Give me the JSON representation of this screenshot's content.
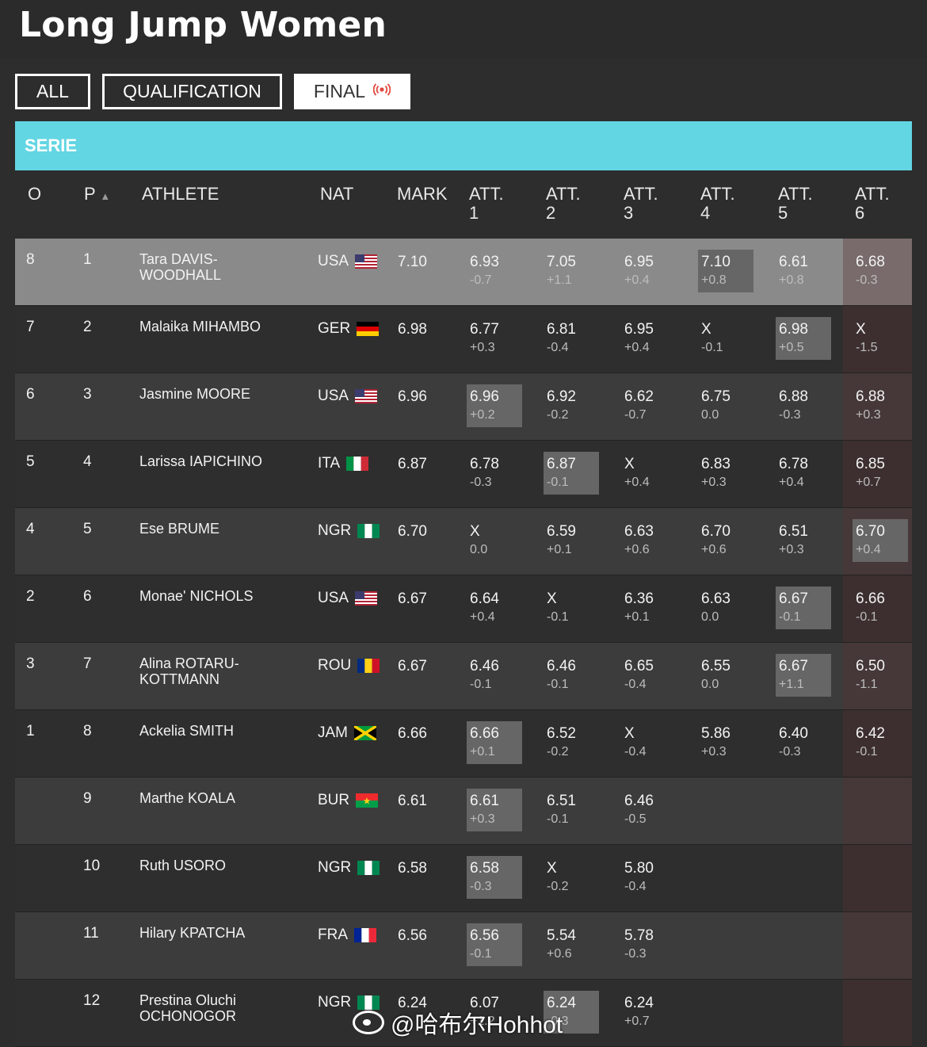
{
  "title": "Long Jump Women",
  "tabs": [
    {
      "label": "ALL",
      "active": false
    },
    {
      "label": "QUALIFICATION",
      "active": false
    },
    {
      "label": "FINAL",
      "active": true,
      "icon": "live-broadcast-icon"
    }
  ],
  "serie_label": "SERIE",
  "headers": {
    "o": "O",
    "p": "P",
    "sort_icon": "▲",
    "athlete": "ATHLETE",
    "nat": "NAT",
    "mark": "MARK",
    "att1": [
      "ATT.",
      "1"
    ],
    "att2": [
      "ATT.",
      "2"
    ],
    "att3": [
      "ATT.",
      "3"
    ],
    "att4": [
      "ATT.",
      "4"
    ],
    "att5": [
      "ATT.",
      "5"
    ],
    "att6": [
      "ATT.",
      "6"
    ]
  },
  "rows": [
    {
      "o": "8",
      "p": "1",
      "athlete": [
        "Tara DAVIS-",
        "WOODHALL"
      ],
      "nat": "USA",
      "flag": "usa",
      "mark": "7.10",
      "atts": [
        [
          "6.93",
          "-0.7"
        ],
        [
          "7.05",
          "+1.1"
        ],
        [
          "6.95",
          "+0.4"
        ],
        [
          "7.10",
          "+0.8"
        ],
        [
          "6.61",
          "+0.8"
        ],
        [
          "6.68",
          "-0.3"
        ]
      ],
      "best": 3
    },
    {
      "o": "7",
      "p": "2",
      "athlete": [
        "Malaika MIHAMBO"
      ],
      "nat": "GER",
      "flag": "ger",
      "mark": "6.98",
      "atts": [
        [
          "6.77",
          "+0.3"
        ],
        [
          "6.81",
          "-0.4"
        ],
        [
          "6.95",
          "+0.4"
        ],
        [
          "X",
          "-0.1"
        ],
        [
          "6.98",
          "+0.5"
        ],
        [
          "X",
          "-1.5"
        ]
      ],
      "best": 4
    },
    {
      "o": "6",
      "p": "3",
      "athlete": [
        "Jasmine MOORE"
      ],
      "nat": "USA",
      "flag": "usa",
      "mark": "6.96",
      "atts": [
        [
          "6.96",
          "+0.2"
        ],
        [
          "6.92",
          "-0.2"
        ],
        [
          "6.62",
          "-0.7"
        ],
        [
          "6.75",
          "0.0"
        ],
        [
          "6.88",
          "-0.3"
        ],
        [
          "6.88",
          "+0.3"
        ]
      ],
      "best": 0
    },
    {
      "o": "5",
      "p": "4",
      "athlete": [
        "Larissa IAPICHINO"
      ],
      "nat": "ITA",
      "flag": "ita",
      "mark": "6.87",
      "atts": [
        [
          "6.78",
          "-0.3"
        ],
        [
          "6.87",
          "-0.1"
        ],
        [
          "X",
          "+0.4"
        ],
        [
          "6.83",
          "+0.3"
        ],
        [
          "6.78",
          "+0.4"
        ],
        [
          "6.85",
          "+0.7"
        ]
      ],
      "best": 1
    },
    {
      "o": "4",
      "p": "5",
      "athlete": [
        "Ese BRUME"
      ],
      "nat": "NGR",
      "flag": "ngr",
      "mark": "6.70",
      "atts": [
        [
          "X",
          "0.0"
        ],
        [
          "6.59",
          "+0.1"
        ],
        [
          "6.63",
          "+0.6"
        ],
        [
          "6.70",
          "+0.6"
        ],
        [
          "6.51",
          "+0.3"
        ],
        [
          "6.70",
          "+0.4"
        ]
      ],
      "best": 5
    },
    {
      "o": "2",
      "p": "6",
      "athlete": [
        "Monae' NICHOLS"
      ],
      "nat": "USA",
      "flag": "usa",
      "mark": "6.67",
      "atts": [
        [
          "6.64",
          "+0.4"
        ],
        [
          "X",
          "-0.1"
        ],
        [
          "6.36",
          "+0.1"
        ],
        [
          "6.63",
          "0.0"
        ],
        [
          "6.67",
          "-0.1"
        ],
        [
          "6.66",
          "-0.1"
        ]
      ],
      "best": 4
    },
    {
      "o": "3",
      "p": "7",
      "athlete": [
        "Alina ROTARU-",
        "KOTTMANN"
      ],
      "nat": "ROU",
      "flag": "rou",
      "mark": "6.67",
      "atts": [
        [
          "6.46",
          "-0.1"
        ],
        [
          "6.46",
          "-0.1"
        ],
        [
          "6.65",
          "-0.4"
        ],
        [
          "6.55",
          "0.0"
        ],
        [
          "6.67",
          "+1.1"
        ],
        [
          "6.50",
          "-1.1"
        ]
      ],
      "best": 4
    },
    {
      "o": "1",
      "p": "8",
      "athlete": [
        "Ackelia SMITH"
      ],
      "nat": "JAM",
      "flag": "jam",
      "mark": "6.66",
      "atts": [
        [
          "6.66",
          "+0.1"
        ],
        [
          "6.52",
          "-0.2"
        ],
        [
          "X",
          "-0.4"
        ],
        [
          "5.86",
          "+0.3"
        ],
        [
          "6.40",
          "-0.3"
        ],
        [
          "6.42",
          "-0.1"
        ]
      ],
      "best": 0
    },
    {
      "o": "",
      "p": "9",
      "athlete": [
        "Marthe KOALA"
      ],
      "nat": "BUR",
      "flag": "bur",
      "mark": "6.61",
      "atts": [
        [
          "6.61",
          "+0.3"
        ],
        [
          "6.51",
          "-0.1"
        ],
        [
          "6.46",
          "-0.5"
        ]
      ],
      "best": 0
    },
    {
      "o": "",
      "p": "10",
      "athlete": [
        "Ruth USORO"
      ],
      "nat": "NGR",
      "flag": "ngr",
      "mark": "6.58",
      "atts": [
        [
          "6.58",
          "-0.3"
        ],
        [
          "X",
          "-0.2"
        ],
        [
          "5.80",
          "-0.4"
        ]
      ],
      "best": 0
    },
    {
      "o": "",
      "p": "11",
      "athlete": [
        "Hilary KPATCHA"
      ],
      "nat": "FRA",
      "flag": "fra",
      "mark": "6.56",
      "atts": [
        [
          "6.56",
          "-0.1"
        ],
        [
          "5.54",
          "+0.6"
        ],
        [
          "5.78",
          "-0.3"
        ]
      ],
      "best": 0
    },
    {
      "o": "",
      "p": "12",
      "athlete": [
        "Prestina Oluchi",
        "OCHONOGOR"
      ],
      "nat": "NGR",
      "flag": "ngr",
      "mark": "6.24",
      "atts": [
        [
          "6.07",
          "+1.2"
        ],
        [
          "6.24",
          "-0.3"
        ],
        [
          "6.24",
          "+0.7"
        ]
      ],
      "best": 1
    }
  ],
  "watermark": "@哈布尔Hohhot",
  "colors": {
    "serie_bar": "#63d6e3",
    "highlight_row": "#8a8a8a",
    "best_cell": "#666666",
    "live": "#e0463c"
  }
}
